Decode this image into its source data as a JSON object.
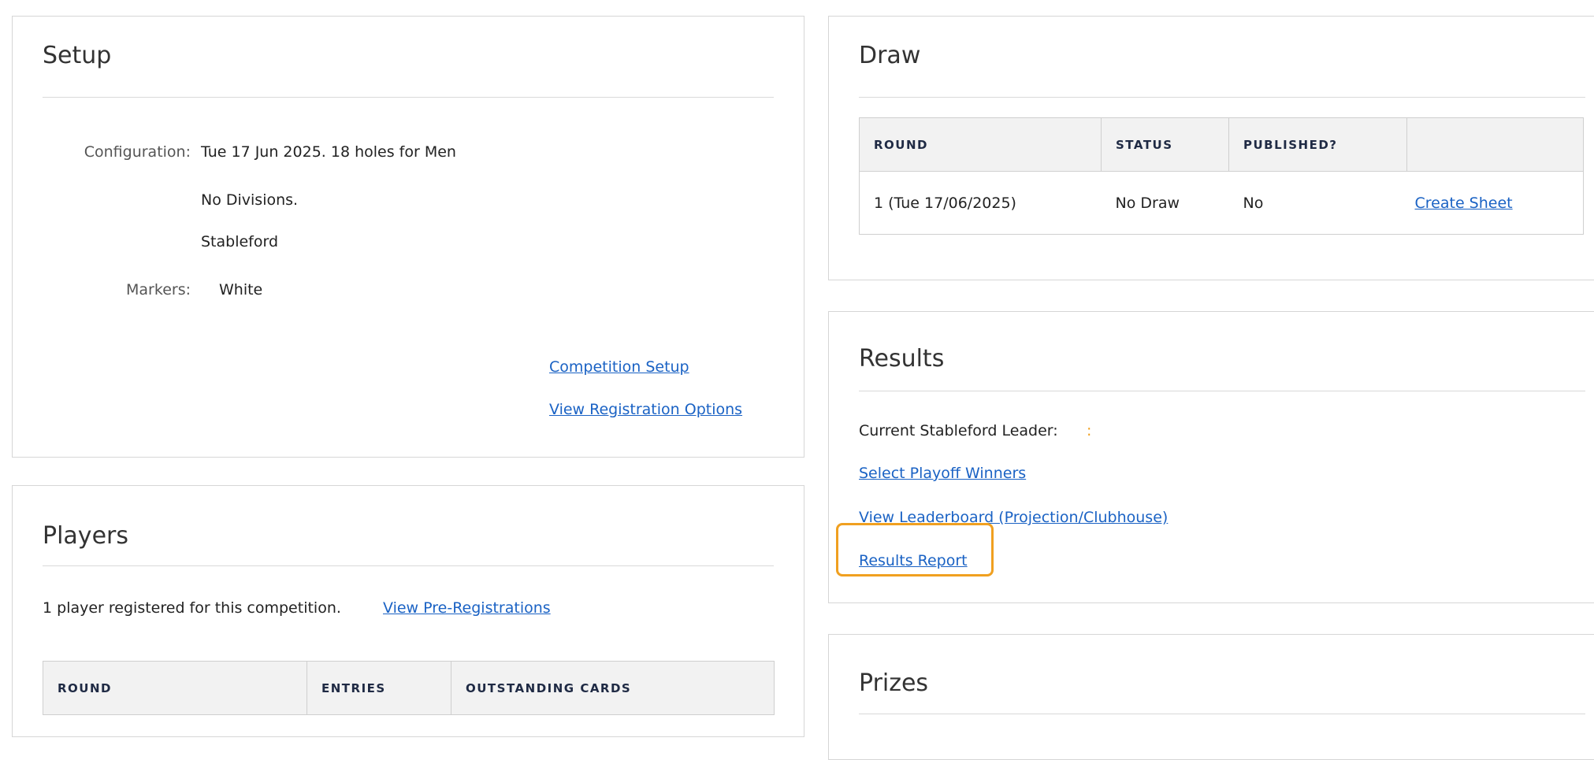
{
  "setup": {
    "title": "Setup",
    "configuration_label": "Configuration:",
    "configuration_lines": [
      "Tue 17 Jun 2025. 18 holes for Men",
      "No Divisions.",
      "Stableford"
    ],
    "markers_label": "Markers:",
    "markers_value": "White",
    "competition_setup_link": "Competition Setup",
    "view_registration_options_link": "View Registration Options"
  },
  "players": {
    "title": "Players",
    "registered_text": "1 player registered for this competition.",
    "view_preregistrations_link": "View Pre-Registrations",
    "table": {
      "headers": [
        "ROUND",
        "ENTRIES",
        "OUTSTANDING CARDS"
      ]
    }
  },
  "draw": {
    "title": "Draw",
    "table": {
      "headers": [
        "ROUND",
        "STATUS",
        "PUBLISHED?",
        ""
      ],
      "rows": [
        {
          "round": "1 (Tue 17/06/2025)",
          "status": "No Draw",
          "published": "No",
          "action": "Create Sheet"
        }
      ]
    }
  },
  "results": {
    "title": "Results",
    "leader_label": "Current Stableford Leader:",
    "leader_value": ":",
    "select_playoff_winners_link": "Select Playoff Winners",
    "view_leaderboard_link": "View Leaderboard (Projection/Clubhouse)",
    "results_report_link": "Results Report"
  },
  "prizes": {
    "title": "Prizes"
  },
  "colors": {
    "link": "#1a62c4",
    "negative": "#c0392b",
    "highlight": "#f0a020",
    "header_text": "#1f2a44"
  }
}
